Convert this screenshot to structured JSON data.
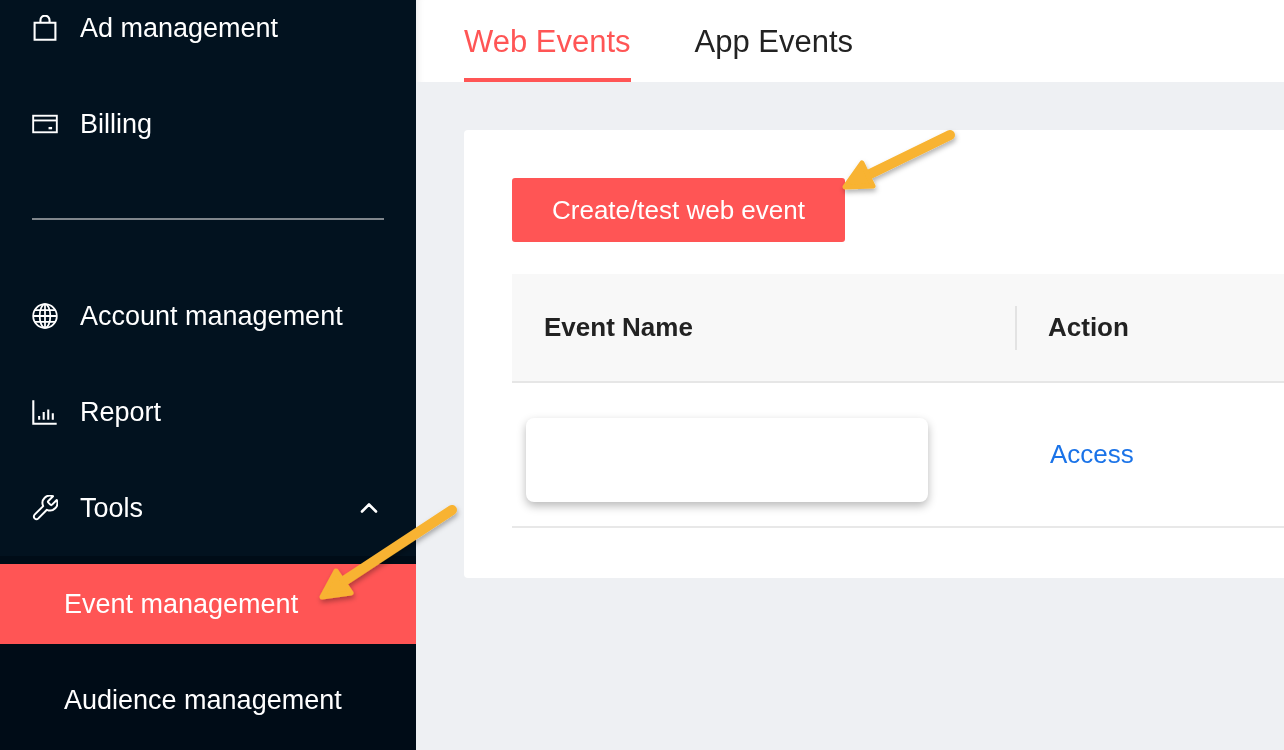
{
  "sidebar": {
    "sections": [
      {
        "items": [
          {
            "label": "Ad management",
            "selected": false
          },
          {
            "label": "Billing",
            "selected": false
          }
        ]
      },
      {
        "items": [
          {
            "label": "Account management",
            "selected": false
          },
          {
            "label": "Report",
            "selected": false
          },
          {
            "label": "Tools",
            "selected": false,
            "expanded": true,
            "children": [
              {
                "label": "Event management",
                "selected": true
              },
              {
                "label": "Audience management",
                "selected": false
              }
            ]
          }
        ]
      }
    ]
  },
  "tabs": [
    {
      "label": "Web Events",
      "selected": true
    },
    {
      "label": "App Events",
      "selected": false
    }
  ],
  "events_panel": {
    "create_button": "Create/test web event",
    "table": {
      "columns": [
        "Event Name",
        "Action"
      ],
      "rows": [
        {
          "name_hidden": true,
          "action": "Access"
        }
      ]
    }
  }
}
